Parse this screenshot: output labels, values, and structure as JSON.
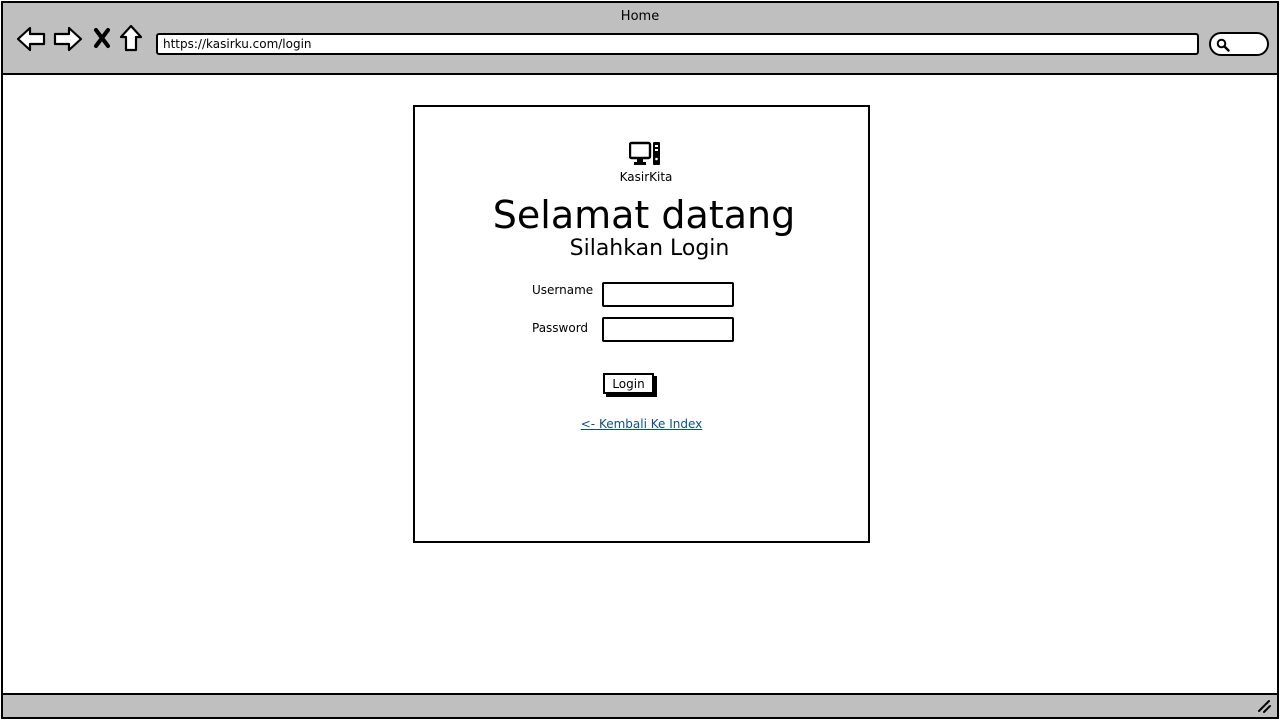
{
  "browser": {
    "title": "Home",
    "url": "https://kasirku.com/login"
  },
  "card": {
    "brand": "KasirKita",
    "heading": "Selamat datang",
    "subheading": "Silahkan Login",
    "username_label": "Username",
    "password_label": "Password",
    "login_button": "Login",
    "back_link": "<- Kembali Ke Index"
  },
  "icons": {
    "back": "arrow-left-icon",
    "forward": "arrow-right-icon",
    "stop": "close-icon",
    "home": "home-icon",
    "search": "search-icon",
    "logo": "desktop-computer-icon",
    "resize": "resize-grip-icon"
  }
}
